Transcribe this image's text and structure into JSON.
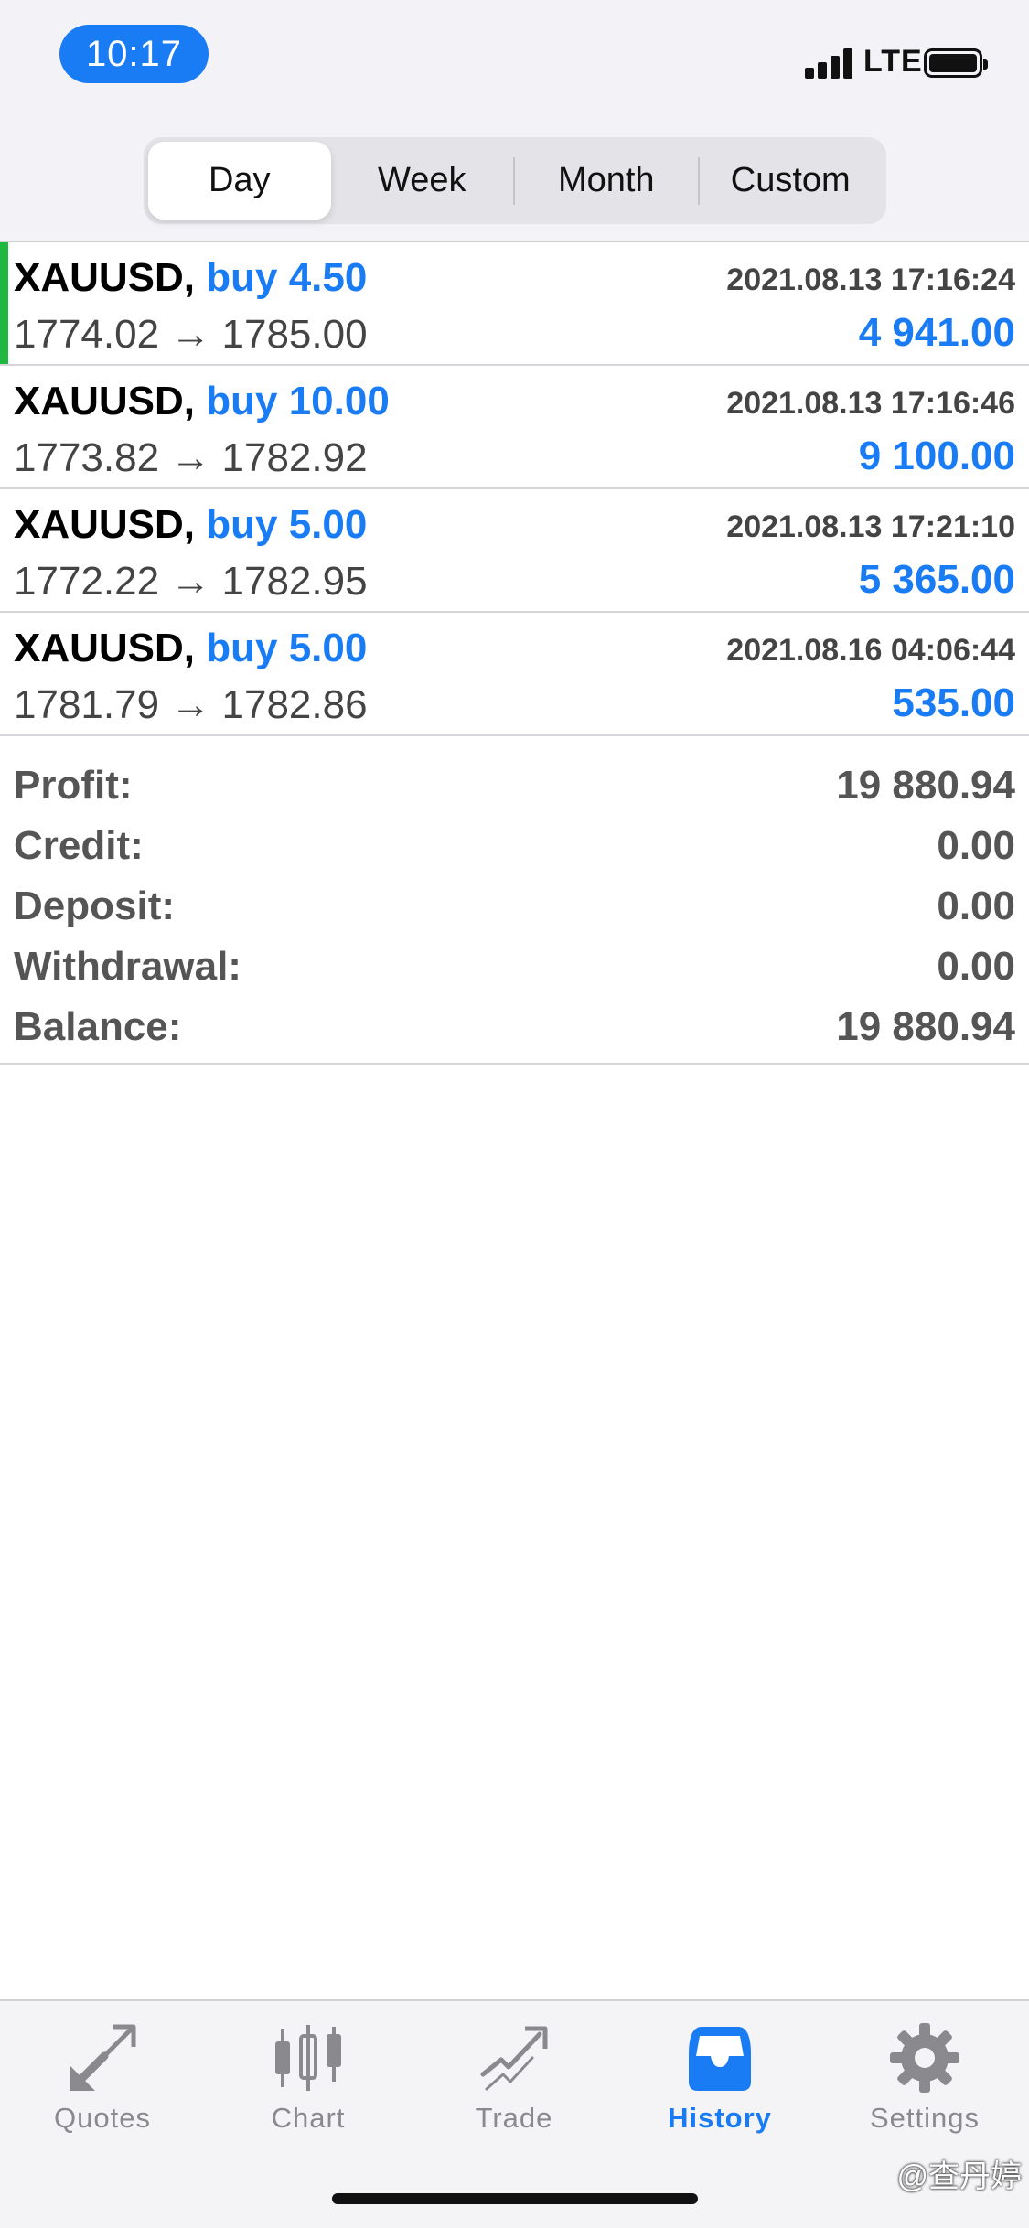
{
  "status_bar": {
    "time": "10:17",
    "network": "LTE"
  },
  "period_tabs": [
    {
      "label": "Day",
      "active": true
    },
    {
      "label": "Week",
      "active": false
    },
    {
      "label": "Month",
      "active": false
    },
    {
      "label": "Custom",
      "active": false
    }
  ],
  "deals": [
    {
      "symbol": "XAUUSD,",
      "side": "buy 4.50",
      "datetime": "2021.08.13 17:16:24",
      "prices": "1774.02 → 1785.00",
      "profit": "4 941.00"
    },
    {
      "symbol": "XAUUSD,",
      "side": "buy 10.00",
      "datetime": "2021.08.13 17:16:46",
      "prices": "1773.82 → 1782.92",
      "profit": "9 100.00"
    },
    {
      "symbol": "XAUUSD,",
      "side": "buy 5.00",
      "datetime": "2021.08.13 17:21:10",
      "prices": "1772.22 → 1782.95",
      "profit": "5 365.00"
    },
    {
      "symbol": "XAUUSD,",
      "side": "buy 5.00",
      "datetime": "2021.08.16 04:06:44",
      "prices": "1781.79 → 1782.86",
      "profit": "535.00"
    }
  ],
  "summary": [
    {
      "label": "Profit:",
      "value": "19 880.94"
    },
    {
      "label": "Credit:",
      "value": "0.00"
    },
    {
      "label": "Deposit:",
      "value": "0.00"
    },
    {
      "label": "Withdrawal:",
      "value": "0.00"
    },
    {
      "label": "Balance:",
      "value": "19 880.94"
    }
  ],
  "tab_bar": [
    {
      "label": "Quotes",
      "icon": "quotes-arrows-icon",
      "active": false
    },
    {
      "label": "Chart",
      "icon": "candlestick-icon",
      "active": false
    },
    {
      "label": "Trade",
      "icon": "trend-arrow-icon",
      "active": false
    },
    {
      "label": "History",
      "icon": "inbox-tray-icon",
      "active": true
    },
    {
      "label": "Settings",
      "icon": "gear-icon",
      "active": false
    }
  ],
  "watermark": "@查丹婷",
  "colors": {
    "accent": "#1a7cf5",
    "selected_marker": "#1fb83f",
    "text_secondary": "#555555"
  }
}
